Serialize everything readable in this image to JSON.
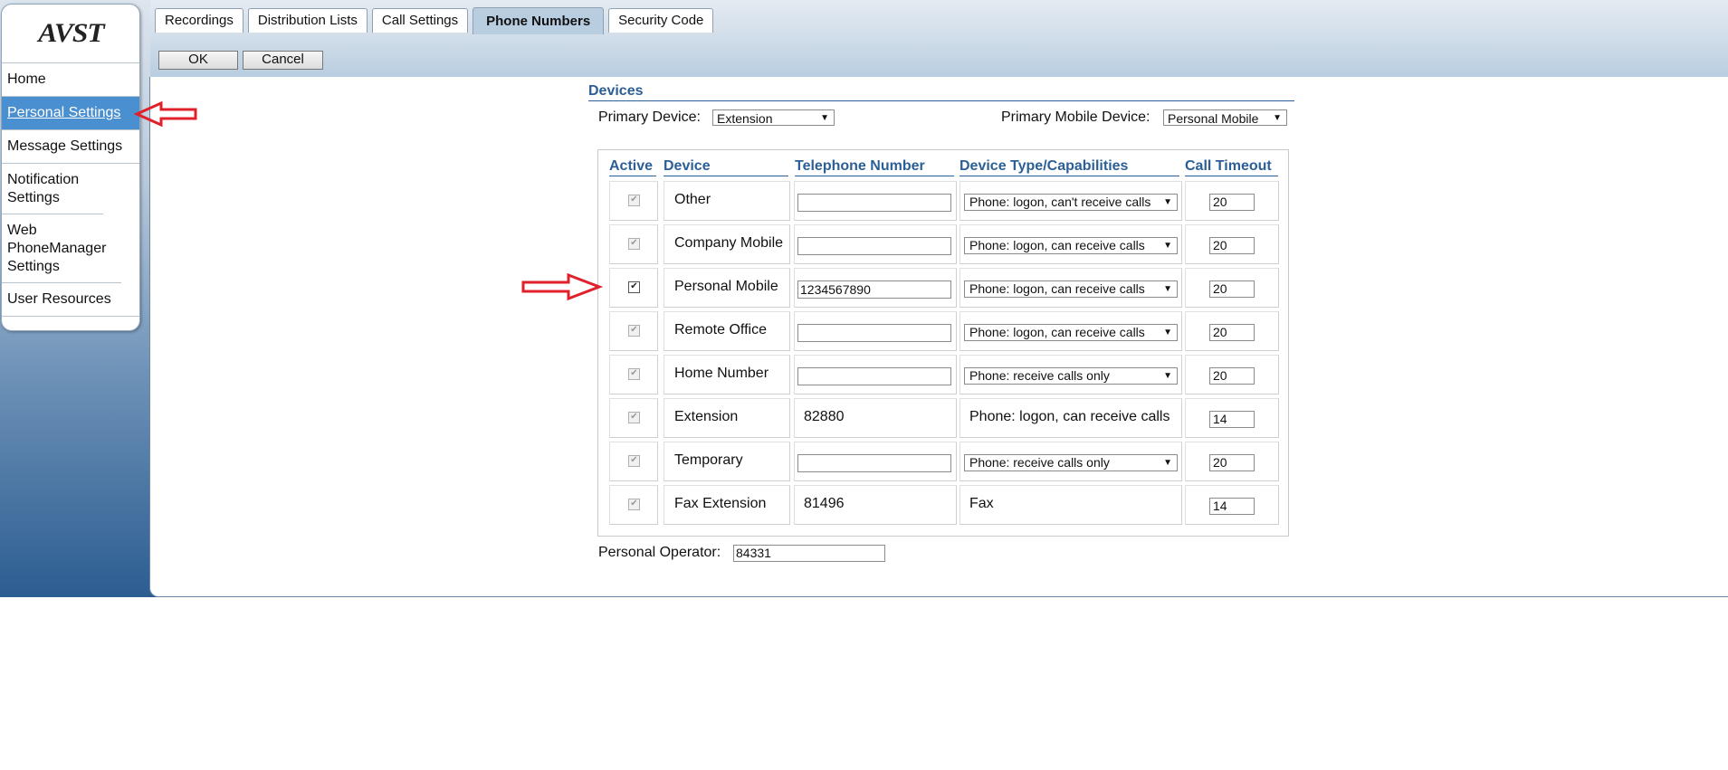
{
  "sidebar": {
    "logo": "AVST",
    "items": [
      {
        "label": "Home"
      },
      {
        "label": "Personal Settings",
        "active": true
      },
      {
        "label": "Message Settings"
      },
      {
        "label": "Notification Settings"
      },
      {
        "label": "Web PhoneManager Settings"
      },
      {
        "label": "User Resources"
      }
    ]
  },
  "tabs": [
    "Recordings",
    "Distribution Lists",
    "Call Settings",
    "Phone Numbers",
    "Security Code"
  ],
  "active_tab": "Phone Numbers",
  "toolbar": {
    "ok_label": "OK",
    "cancel_label": "Cancel"
  },
  "devices": {
    "title": "Devices",
    "primary_device_label": "Primary Device:",
    "primary_device_value": "Extension",
    "primary_mobile_label": "Primary Mobile Device:",
    "primary_mobile_value": "Personal Mobile",
    "columns": [
      "Active",
      "Device",
      "Telephone Number",
      "Device Type/Capabilities",
      "Call Timeout"
    ],
    "rows": [
      {
        "active": false,
        "device": "Other",
        "number": "",
        "editable": true,
        "type": "Phone: logon, can't receive calls",
        "type_select": true,
        "timeout": "20"
      },
      {
        "active": false,
        "device": "Company Mobile",
        "number": "",
        "editable": true,
        "type": "Phone: logon, can receive calls",
        "type_select": true,
        "timeout": "20"
      },
      {
        "active": true,
        "device": "Personal Mobile",
        "number": "1234567890",
        "editable": true,
        "type": "Phone: logon, can receive calls",
        "type_select": true,
        "timeout": "20"
      },
      {
        "active": false,
        "device": "Remote Office",
        "number": "",
        "editable": true,
        "type": "Phone: logon, can receive calls",
        "type_select": true,
        "timeout": "20"
      },
      {
        "active": false,
        "device": "Home Number",
        "number": "",
        "editable": true,
        "type": "Phone: receive calls only",
        "type_select": true,
        "timeout": "20"
      },
      {
        "active": false,
        "device": "Extension",
        "number": "82880",
        "editable": false,
        "type": "Phone: logon, can receive calls",
        "type_select": false,
        "timeout": "14"
      },
      {
        "active": false,
        "device": "Temporary",
        "number": "",
        "editable": true,
        "type": "Phone: receive calls only",
        "type_select": true,
        "timeout": "20"
      },
      {
        "active": false,
        "device": "Fax Extension",
        "number": "81496",
        "editable": false,
        "type": "Fax",
        "type_select": false,
        "timeout": "14"
      }
    ],
    "operator_label": "Personal Operator:",
    "operator_value": "84331"
  },
  "colors": {
    "accent": "#2b5f95",
    "active_nav": "#4a8fd0",
    "annotation_arrow": "#e0202a"
  }
}
